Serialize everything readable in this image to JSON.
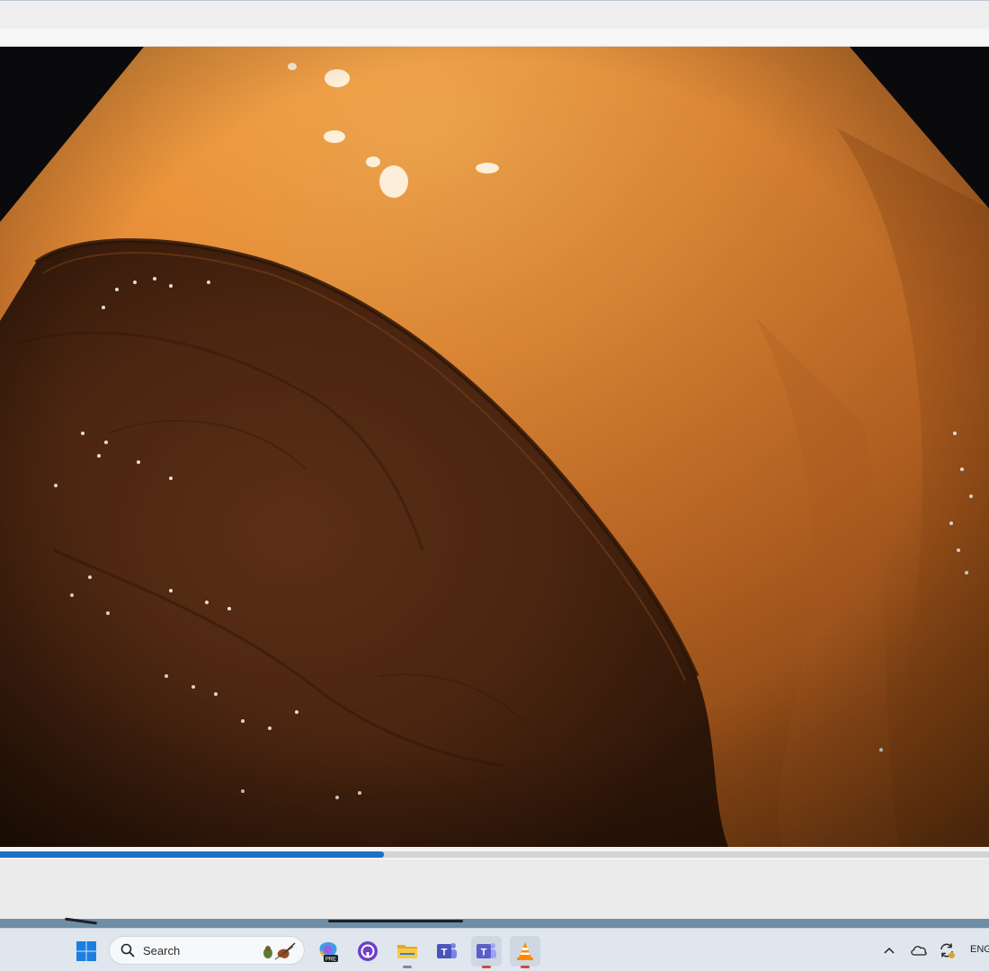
{
  "player": {
    "progress_fraction": 0.388
  },
  "taskbar": {
    "search_label": "Search",
    "apps": [
      "windows-start",
      "copilot-preview",
      "github-desktop",
      "file-explorer",
      "teams-classic",
      "teams-new",
      "vlc-media-player"
    ]
  },
  "tray": {
    "language": "ENG"
  },
  "colors": {
    "accent": "#1f6fc7",
    "taskbar": "#dfe6ee"
  }
}
